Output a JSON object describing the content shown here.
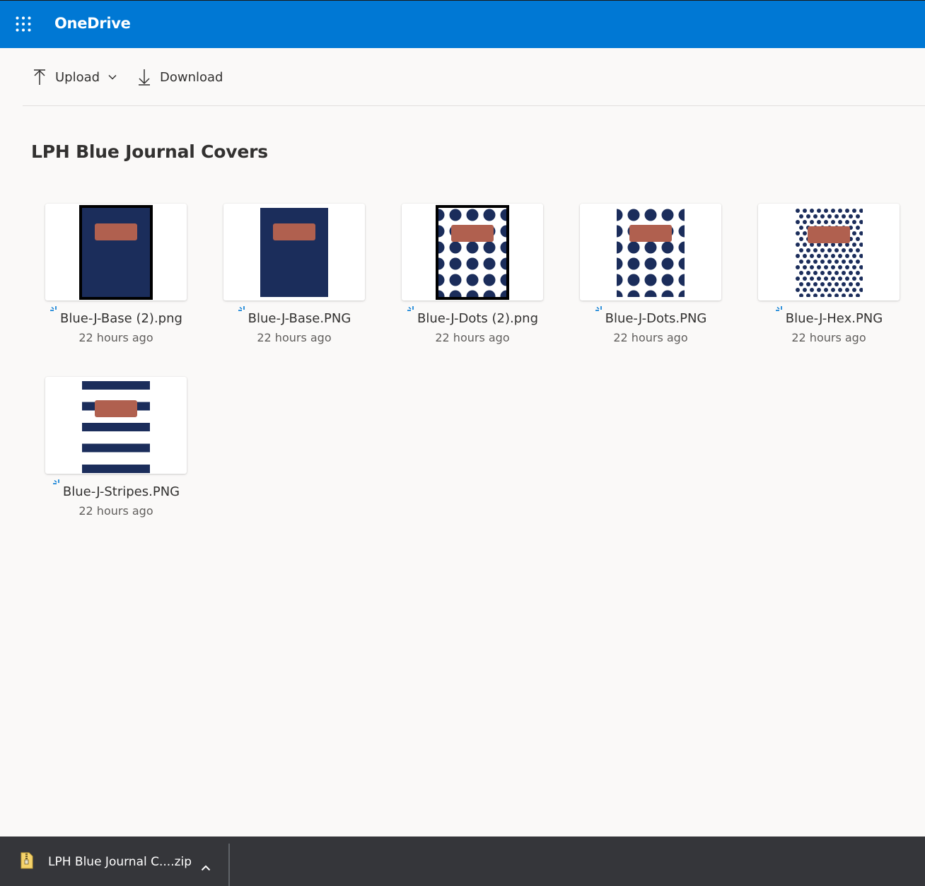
{
  "app": {
    "name": "OneDrive",
    "accent_color": "#0078d4",
    "launcher_icon": "waffle-icon"
  },
  "toolbar": {
    "upload_label": "Upload",
    "upload_icon": "upload-arrow-icon",
    "upload_menu_icon": "chevron-down-icon",
    "download_label": "Download",
    "download_icon": "download-arrow-icon"
  },
  "folder": {
    "title": "LPH Blue Journal Covers"
  },
  "files": [
    {
      "name": "Blue-J-Base (2).png",
      "modified": "22 hours ago",
      "pattern": "base-framed"
    },
    {
      "name": "Blue-J-Base.PNG",
      "modified": "22 hours ago",
      "pattern": "base"
    },
    {
      "name": "Blue-J-Dots (2).png",
      "modified": "22 hours ago",
      "pattern": "dots-framed"
    },
    {
      "name": "Blue-J-Dots.PNG",
      "modified": "22 hours ago",
      "pattern": "dots"
    },
    {
      "name": "Blue-J-Hex.PNG",
      "modified": "22 hours ago",
      "pattern": "hex"
    },
    {
      "name": "Blue-J-Stripes.PNG",
      "modified": "22 hours ago",
      "pattern": "stripes"
    }
  ],
  "colors": {
    "navy": "#1b2d5b",
    "label": "#b0604f",
    "sync_icon": "#0078d4"
  },
  "download_shelf": {
    "file_name": "LPH Blue Journal C....zip",
    "file_icon": "zip-archive-icon",
    "expand_icon": "chevron-up-icon"
  }
}
